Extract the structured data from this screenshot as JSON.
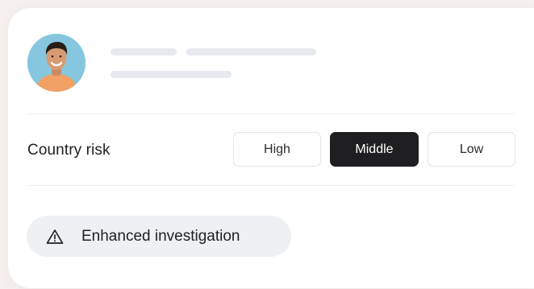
{
  "profile": {
    "avatar_icon": "person-avatar"
  },
  "risk": {
    "label": "Country risk",
    "options": [
      "High",
      "Middle",
      "Low"
    ],
    "selected": "Middle"
  },
  "badge": {
    "icon": "warning-triangle-icon",
    "text": "Enhanced investigation"
  },
  "colors": {
    "selected_bg": "#1f1f21",
    "selected_text": "#ffffff",
    "badge_bg": "#eef0f4",
    "page_bg": "#f6f1ef"
  }
}
